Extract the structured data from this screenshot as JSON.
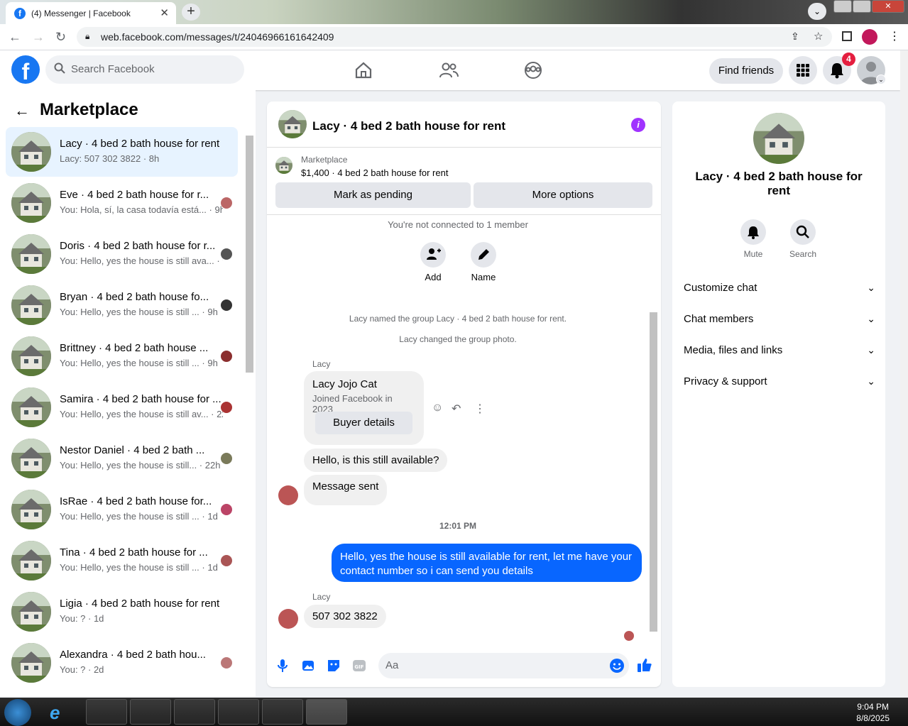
{
  "browser": {
    "tab_title": "(4) Messenger | Facebook",
    "url": "web.facebook.com/messages/t/24046966161642409"
  },
  "header": {
    "search_placeholder": "Search Facebook",
    "find_friends": "Find friends",
    "notif_count": "4"
  },
  "left": {
    "title": "Marketplace",
    "conversations": [
      {
        "name": "Lacy · 4 bed 2 bath house for rent",
        "msg": "Lacy: 507 302 3822 · 8h",
        "active": true
      },
      {
        "name": "Eve · 4 bed 2 bath house for r...",
        "msg": "You: Hola, sí, la casa todavía está... · 9h"
      },
      {
        "name": "Doris · 4 bed 2 bath house for r...",
        "msg": "You: Hello, yes the house is still ava... · 9h"
      },
      {
        "name": "Bryan · 4 bed 2 bath house fo...",
        "msg": "You: Hello, yes the house is still ... · 9h"
      },
      {
        "name": "Brittney · 4 bed 2 bath house ...",
        "msg": "You: Hello, yes the house is still ... · 9h"
      },
      {
        "name": "Samira · 4 bed 2 bath house for ...",
        "msg": "You: Hello, yes the house is still av... · 22h"
      },
      {
        "name": "Nestor Daniel · 4 bed 2 bath ...",
        "msg": "You: Hello, yes the house is still... · 22h"
      },
      {
        "name": "IsRae · 4 bed 2 bath house for...",
        "msg": "You: Hello, yes the house is still ... · 1d"
      },
      {
        "name": "Tina · 4 bed 2 bath house for ...",
        "msg": "You: Hello, yes the house is still ... · 1d"
      },
      {
        "name": "Ligia · 4 bed 2 bath house for rent",
        "msg": "You: ? · 1d"
      },
      {
        "name": "Alexandra · 4 bed 2 bath hou...",
        "msg": "You: ? · 2d"
      }
    ]
  },
  "chat": {
    "title": "Lacy · 4 bed 2 bath house for rent",
    "mp_label": "Marketplace",
    "mp_listing": "$1,400 · 4 bed 2 bath house for rent",
    "mark_pending": "Mark as pending",
    "more_options": "More options",
    "not_connected": "You're not connected to 1 member",
    "add": "Add",
    "name": "Name",
    "sys1": "Lacy named the group Lacy · 4 bed 2 bath house for rent.",
    "sys2": "Lacy changed the group photo.",
    "sender": "Lacy",
    "card_name": "Lacy Jojo Cat",
    "card_sub": "Joined Facebook in 2023",
    "buyer_details": "Buyer details",
    "m1": "Hello, is this still available?",
    "m2": "Message sent",
    "time": "12:01 PM",
    "m3": "Hello, yes the house is still available for rent, let me have your contact number so i can send you  details",
    "m4": "507 302 3822",
    "placeholder": "Aa"
  },
  "right": {
    "title": "Lacy · 4 bed 2 bath house for rent",
    "mute": "Mute",
    "search": "Search",
    "items": [
      "Customize chat",
      "Chat members",
      "Media, files and links",
      "Privacy & support"
    ]
  },
  "taskbar": {
    "time": "9:04 PM",
    "date": "8/8/2025"
  },
  "colors": {
    "accent": "#0866ff",
    "brand": "#1877f2"
  }
}
